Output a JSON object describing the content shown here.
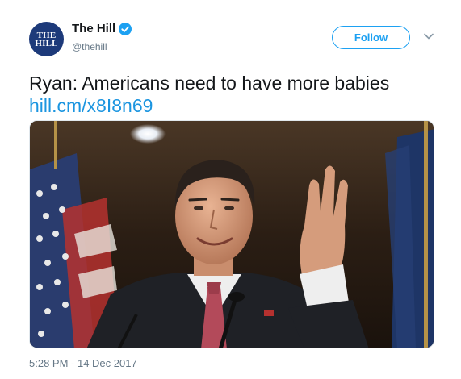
{
  "author": {
    "avatar_line1": "THE",
    "avatar_line2": "HILL",
    "display_name": "The Hill",
    "handle": "@thehill",
    "verified": true
  },
  "actions": {
    "follow_label": "Follow",
    "more_icon": "chevron-down-icon"
  },
  "tweet": {
    "text": "Ryan: Americans need to have more babies",
    "link": "hill.cm/x8I8n69"
  },
  "media": {
    "type": "photo"
  },
  "meta": {
    "timestamp": "5:28 PM - 14 Dec 2017"
  },
  "colors": {
    "accent": "#1da1f2",
    "link": "#1b95e0",
    "muted": "#657786",
    "avatar_bg": "#1d3a7a"
  }
}
